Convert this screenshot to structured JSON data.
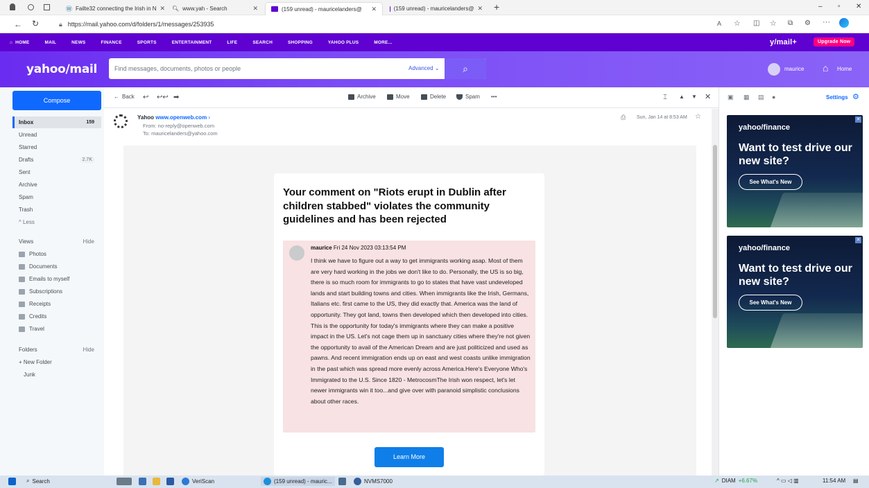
{
  "browser": {
    "tabs": [
      {
        "label": "Failte32 connecting the Irish in N"
      },
      {
        "label": "www.yah - Search"
      },
      {
        "label": "(159 unread) - mauricelanders@"
      },
      {
        "label": "(159 unread) - mauricelanders@"
      }
    ],
    "url": "https://mail.yahoo.com/d/folders/1/messages/253935"
  },
  "topnav": {
    "items": [
      "HOME",
      "MAIL",
      "NEWS",
      "FINANCE",
      "SPORTS",
      "ENTERTAINMENT",
      "LIFE",
      "SEARCH",
      "SHOPPING",
      "YAHOO PLUS",
      "MORE..."
    ],
    "brand": "y/mail+",
    "upgrade": "Upgrade Now"
  },
  "header": {
    "logo": "yahoo/mail",
    "search_placeholder": "Find messages, documents, photos or people",
    "advanced": "Advanced",
    "user": "maurice",
    "home": "Home"
  },
  "sidebar": {
    "compose": "Compose",
    "folders": [
      {
        "label": "Inbox",
        "count": "159"
      },
      {
        "label": "Unread",
        "count": ""
      },
      {
        "label": "Starred",
        "count": ""
      },
      {
        "label": "Drafts",
        "count": "2.7K"
      },
      {
        "label": "Sent",
        "count": ""
      },
      {
        "label": "Archive",
        "count": ""
      },
      {
        "label": "Spam",
        "count": ""
      },
      {
        "label": "Trash",
        "count": ""
      },
      {
        "label": "^ Less",
        "count": ""
      }
    ],
    "views_label": "Views",
    "views_hide": "Hide",
    "views": [
      "Photos",
      "Documents",
      "Emails to myself",
      "Subscriptions",
      "Receipts",
      "Credits",
      "Travel"
    ],
    "folders_label": "Folders",
    "folders_hide": "Hide",
    "new_folder": "+ New Folder",
    "junk": "Junk"
  },
  "toolbar": {
    "back": "Back",
    "archive": "Archive",
    "move": "Move",
    "delete": "Delete",
    "spam": "Spam",
    "more": "•••"
  },
  "message": {
    "sender_name": "Yahoo",
    "sender_link": "www.openweb.com",
    "from": "From: no-reply@openweb.com",
    "to": "To: mauricelanders@yahoo.com",
    "date": "Sun, Jan 14 at 8:53 AM",
    "subject": "Your comment on \"Riots erupt in Dublin after children stabbed\" violates the community guidelines and has been rejected",
    "comment_author": "maurice",
    "comment_date": "Fri 24 Nov 2023 03:13:54 PM",
    "comment_body": "I think we have to figure out a way to get immigrants working asap. Most of them are very hard working in the jobs we don't like to do. Personally, the US is so big, there is so much room for immigrants to go to states that have vast undeveloped lands and start building towns and cities. When immigrants like the Irish, Germans, Italians etc. first came to the US, they did exactly that. America was the land of opportunity. They got land, towns then developed which then developed into cities. This is the opportunity for today's immigrants where they can make a positive impact in the US. Let's not cage them up in sanctuary cities where they're not given the opportunity to avail of the American Dream and are just politicized and used as pawns. And recent immigration ends up on east and west coasts unlike immigration in the past which was spread more evenly across America.Here's Everyone Who's Immigrated to the U.S. Since 1820 - MetrocosmThe Irish won respect, let's let newer immigrants win it too...and give over with paranoid simplistic conclusions about other races.",
    "learn_more": "Learn More"
  },
  "rightpane": {
    "settings": "Settings",
    "ads": [
      {
        "brand": "yahoo/finance",
        "headline": "Want to test drive our new site?",
        "cta": "See What's New"
      },
      {
        "brand": "yahoo/finance",
        "headline": "Want to test drive our new site?",
        "cta": "See What's New"
      }
    ]
  },
  "taskbar": {
    "search": "Search",
    "veriscan": "VeriScan",
    "mail": "(159 unread) - mauric...",
    "nvms": "NVMS7000",
    "stock": "DIAM",
    "stock_change": "+6.67%",
    "time": "11:54 AM"
  },
  "colors": {
    "accent": "#5f01d1",
    "compose": "#0f69ff",
    "comment_bg": "#f8e2e3"
  }
}
